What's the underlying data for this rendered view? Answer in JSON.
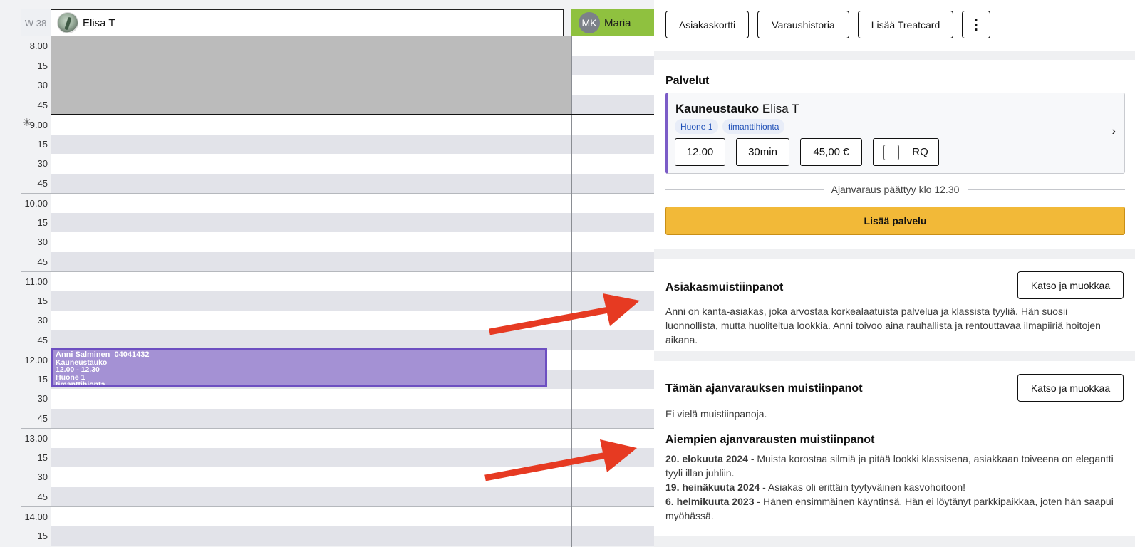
{
  "calendar": {
    "week_label": "W 38",
    "staff": [
      {
        "name": "Elisa T",
        "avatar": "avatar-photo"
      },
      {
        "name": "Maria",
        "initials": "MK",
        "color": "#8fc13f"
      }
    ],
    "time_slots": [
      "8.00",
      "15",
      "30",
      "45",
      "9.00",
      "15",
      "30",
      "45",
      "10.00",
      "15",
      "30",
      "45",
      "11.00",
      "15",
      "30",
      "45",
      "12.00",
      "15",
      "30",
      "45",
      "13.00",
      "15",
      "30",
      "45",
      "14.00",
      "15"
    ],
    "now_icon": "sun-icon",
    "appointment": {
      "client_name": "Anni Salminen",
      "phone": "04041432",
      "service": "Kauneustauko",
      "time": "12.00 - 12.30",
      "room": "Huone 1",
      "tag": "timanttihionta",
      "color": "#a491d4",
      "border_color": "#6d4fc1"
    }
  },
  "toolbar": {
    "buttons": [
      "Asiakaskortti",
      "Varaushistoria",
      "Lisää Treatcard"
    ],
    "more_icon": "more-vertical-icon"
  },
  "services": {
    "heading": "Palvelut",
    "item": {
      "service_name": "Kauneustauko",
      "staff_name": "Elisa T",
      "tags": [
        "Huone 1",
        "timanttihionta"
      ],
      "start_time": "12.00",
      "duration": "30min",
      "price": "45,00 €",
      "rq_label": "RQ",
      "rq_checked": false,
      "accent_color": "#7b5cc7"
    },
    "ends_text": "Ajanvaraus päättyy klo 12.30",
    "add_button": "Lisää palvelu",
    "add_button_color": "#f2b938"
  },
  "client_notes": {
    "heading": "Asiakasmuistiinpanot",
    "edit_button": "Katso ja muokkaa",
    "text": "Anni on kanta-asiakas, joka arvostaa korkealaatuista palvelua ja klassista tyyliä. Hän suosii luonnollista, mutta huoliteltua lookkia. Anni toivoo aina rauhallista ja rentouttavaa ilmapiiriä hoitojen aikana."
  },
  "booking_notes": {
    "heading": "Tämän ajanvarauksen muistiinpanot",
    "edit_button": "Katso ja muokkaa",
    "empty_text": "Ei vielä muistiinpanoja."
  },
  "previous_notes": {
    "heading": "Aiempien ajanvarausten muistiinpanot",
    "entries": [
      {
        "date": "20. elokuuta 2024",
        "text": " - Muista korostaa silmiä ja pitää lookki klassisena, asiakkaan toiveena on elegantti tyyli illan juhliin."
      },
      {
        "date": "19. heinäkuuta 2024",
        "text": " - Asiakas oli erittäin tyytyväinen kasvohoitoon!"
      },
      {
        "date": "6. helmikuuta 2023",
        "text": " - Hänen ensimmäinen käyntinsä. Hän ei löytänyt parkkipaikkaa, joten hän saapui myöhässä."
      }
    ]
  },
  "annotations": {
    "arrow_color": "#e63a22"
  }
}
